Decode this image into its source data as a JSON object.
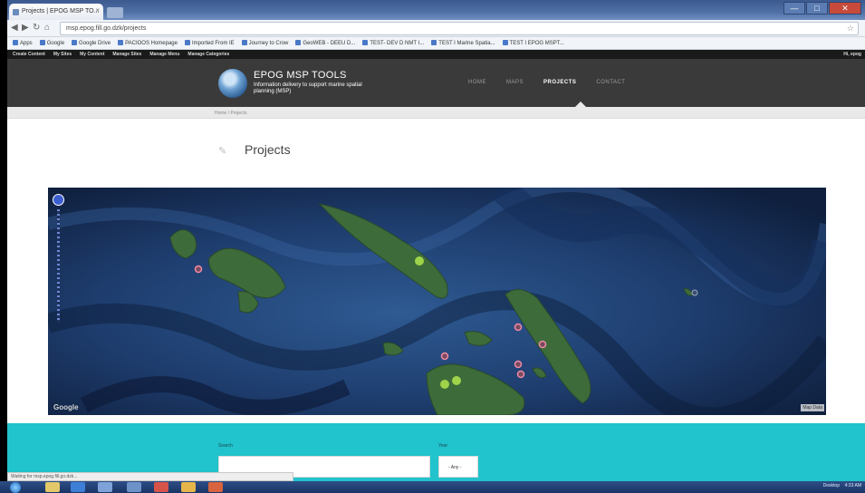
{
  "browser": {
    "tab_title": "Projects | EPOG MSP TO...",
    "tab_close": "×",
    "address": "msp.epog.fill.go.dzk/projects",
    "window_controls": [
      "—",
      "□",
      "✕"
    ],
    "nav": {
      "back": "◀",
      "forward": "▶",
      "reload": "↻",
      "home": "⌂",
      "star": "☆"
    },
    "bookmarks": [
      "Apps",
      "Google",
      "Google Drive",
      "PACIOOS Homepage",
      "Imported From IE",
      "Journey to Crow",
      "GeoWEB - DEEU D...",
      "TEST- DEV D NMT I...",
      "TEST I Marine Spatia...",
      "TEST I EPOG MSPT..."
    ]
  },
  "admin_bar": {
    "items": [
      "Create Content",
      "My Sites",
      "My Content",
      "Manage Sites",
      "Manage Menu",
      "Manage Categories"
    ],
    "right": "Hi, epog"
  },
  "site": {
    "name": "EPOG MSP TOOLS",
    "slogan": "Information delivery to support marine spatial planning (MSP)",
    "nav": [
      "HOME",
      "MAPS",
      "PROJECTS",
      "CONTACT"
    ],
    "active_nav": "PROJECTS",
    "breadcrumb": "Home  /  Projects"
  },
  "page": {
    "pencil_icon": "✎",
    "title": "Projects"
  },
  "map": {
    "attribution_logo": "Google",
    "map_data": "Map Data",
    "markers": {
      "green": 3,
      "pink": 7
    }
  },
  "filters": {
    "search_label": "Search",
    "search_placeholder": "",
    "year_label": "Year",
    "year_value": "- Any -"
  },
  "status_bar": "Waiting for msp.epog.fill.go.dzk...",
  "taskbar": {
    "tray_text": "Desktop",
    "clock": "4:33 AM"
  },
  "colors": {
    "site_header": "#3a3a3a",
    "filter_band": "#21c3cc",
    "marker_green": "#9ed34a",
    "marker_pink": "#f08aa6"
  }
}
